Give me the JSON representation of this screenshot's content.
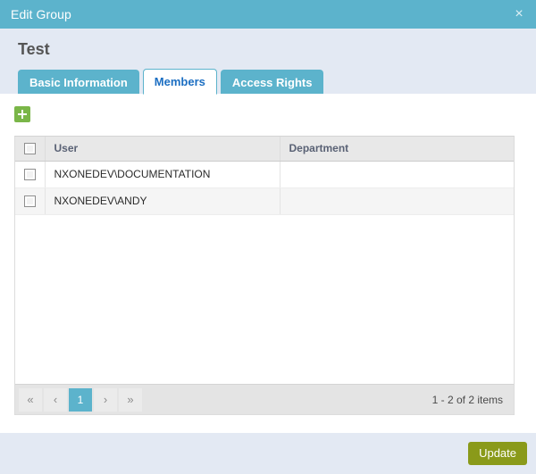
{
  "titlebar": {
    "title": "Edit Group",
    "close_label": "×"
  },
  "header": {
    "page_title": "Test",
    "tabs": [
      {
        "label": "Basic Information",
        "active": false
      },
      {
        "label": "Members",
        "active": true
      },
      {
        "label": "Access Rights",
        "active": false
      }
    ]
  },
  "toolbar": {
    "add_label": "+"
  },
  "grid": {
    "columns": [
      "",
      "User",
      "Department"
    ],
    "rows": [
      {
        "user": "NXONEDEV\\DOCUMENTATION",
        "department": ""
      },
      {
        "user": "NXONEDEV\\ANDY",
        "department": ""
      }
    ]
  },
  "pager": {
    "first_label": "«",
    "prev_label": "‹",
    "pages": [
      "1"
    ],
    "next_label": "›",
    "last_label": "»",
    "info": "1 - 2 of 2 items"
  },
  "footer": {
    "update_label": "Update"
  },
  "colors": {
    "accent": "#5cb3cc",
    "header_band": "#e3e9f3",
    "add_green": "#7ab648",
    "update_olive": "#8a9a1a",
    "tab_active_text": "#1b6ec2"
  }
}
